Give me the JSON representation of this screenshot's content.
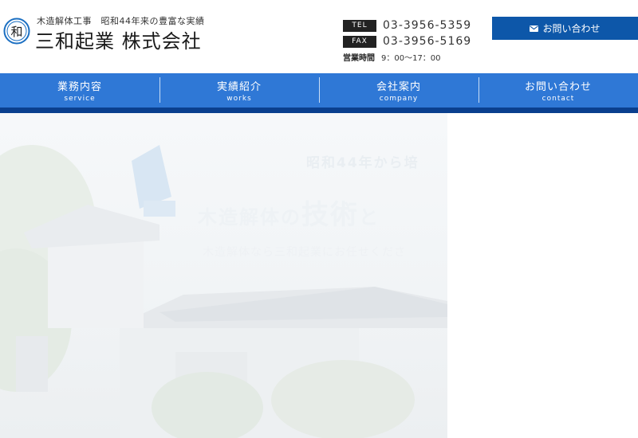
{
  "header": {
    "tagline": "木造解体工事　昭和44年来の豊富な実績",
    "company_name": "三和起業 株式会社",
    "logo_char": "和",
    "tel_label": "TEL",
    "tel": "03-3956-5359",
    "fax_label": "FAX",
    "fax": "03-3956-5169",
    "hours_label": "営業時間",
    "hours": "9：00〜17：00",
    "contact_button": "お問い合わせ",
    "contact_icon": "envelope-icon"
  },
  "nav": {
    "items": [
      {
        "ja": "業務内容",
        "en": "service"
      },
      {
        "ja": "実績紹介",
        "en": "works"
      },
      {
        "ja": "会社案内",
        "en": "company"
      },
      {
        "ja": "お問い合わせ",
        "en": "contact"
      }
    ]
  },
  "hero": {
    "line1": "昭和44年から培",
    "line2_a": "木造解体の",
    "line2_b": "技術",
    "line2_c": "と",
    "line3": "木造解体なら三和起業にお任せくださ"
  },
  "colors": {
    "accent": "#0d57a9",
    "nav": "#2f78d6",
    "nav_bottom": "#0a3f8e",
    "label_bg": "#222222"
  }
}
